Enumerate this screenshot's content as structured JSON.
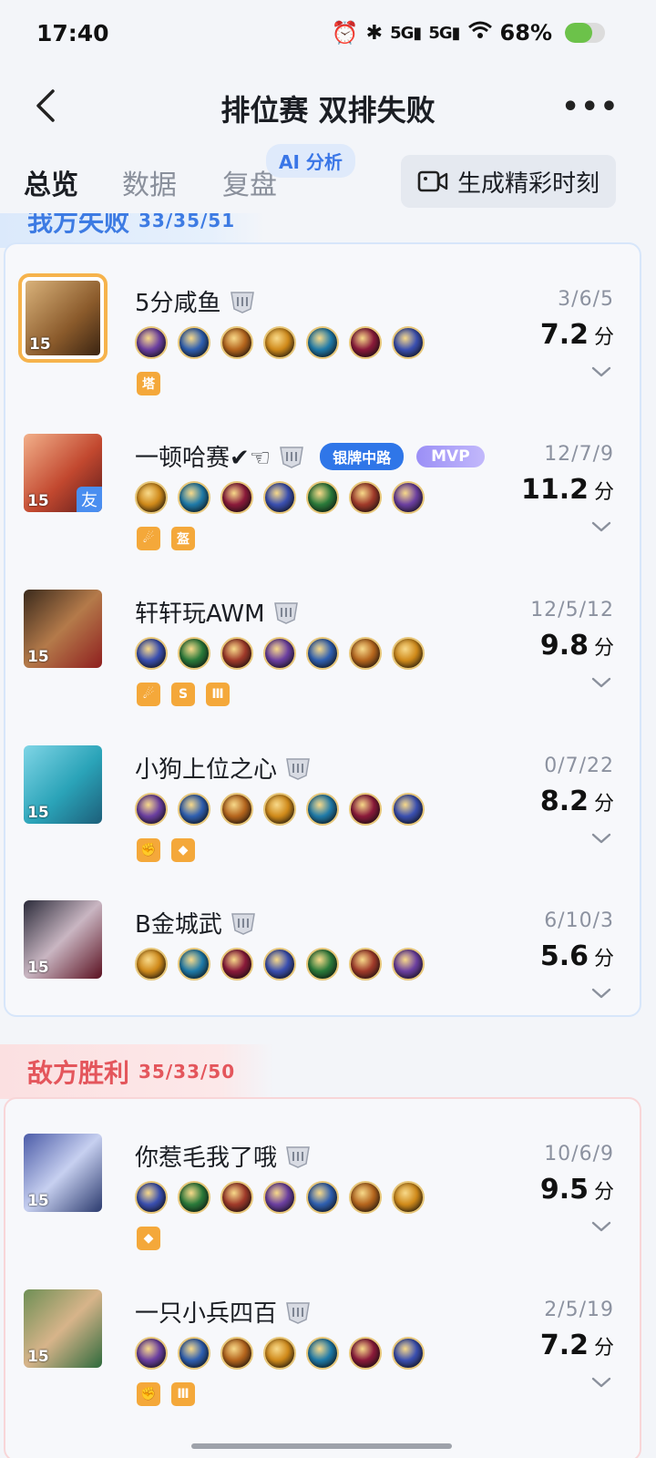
{
  "status_bar": {
    "time": "17:40",
    "network_1": "5G",
    "network_2": "5G",
    "battery_percent": "68%",
    "battery_level": 0.68
  },
  "header": {
    "title": "排位赛 双排失败",
    "more": "•••"
  },
  "tabs": [
    {
      "label": "总览"
    },
    {
      "label": "数据"
    },
    {
      "label": "复盘"
    }
  ],
  "ai_badge": "AI 分析",
  "highlight_button": "生成精彩时刻",
  "ally_team": {
    "label": "我方失败",
    "score": "33/35/51",
    "players": [
      {
        "name": "5分咸鱼",
        "level": "15",
        "kda": "3/6/5",
        "score": "7.2",
        "unit": "分",
        "honors": [
          "塔"
        ]
      },
      {
        "name": "一顿哈赛✔☜",
        "level": "15",
        "friend": "友",
        "role_badge": "银牌中路",
        "mvp": "MVP",
        "kda": "12/7/9",
        "score": "11.2",
        "unit": "分",
        "honors": [
          "☄",
          "盔"
        ]
      },
      {
        "name": "轩轩玩AWM",
        "level": "15",
        "kda": "12/5/12",
        "score": "9.8",
        "unit": "分",
        "honors": [
          "☄",
          "S",
          "Ⅲ"
        ]
      },
      {
        "name": "小狗上位之心",
        "level": "15",
        "kda": "0/7/22",
        "score": "8.2",
        "unit": "分",
        "honors": [
          "✊",
          "◆"
        ]
      },
      {
        "name": "B金城武",
        "level": "15",
        "kda": "6/10/3",
        "score": "5.6",
        "unit": "分",
        "honors": []
      }
    ]
  },
  "enemy_team": {
    "label": "敌方胜利",
    "score": "35/33/50",
    "players": [
      {
        "name": "你惹毛我了哦",
        "level": "15",
        "kda": "10/6/9",
        "score": "9.5",
        "unit": "分",
        "honors": [
          "◆"
        ]
      },
      {
        "name": "一只小兵四百",
        "level": "15",
        "kda": "2/5/19",
        "score": "7.2",
        "unit": "分",
        "honors": [
          "✊",
          "Ⅲ"
        ]
      }
    ]
  },
  "colors": {
    "accent": "#2d6df6",
    "ally": "#3d7be3",
    "enemy": "#e4565c",
    "self_frame": "#f6b34c"
  }
}
